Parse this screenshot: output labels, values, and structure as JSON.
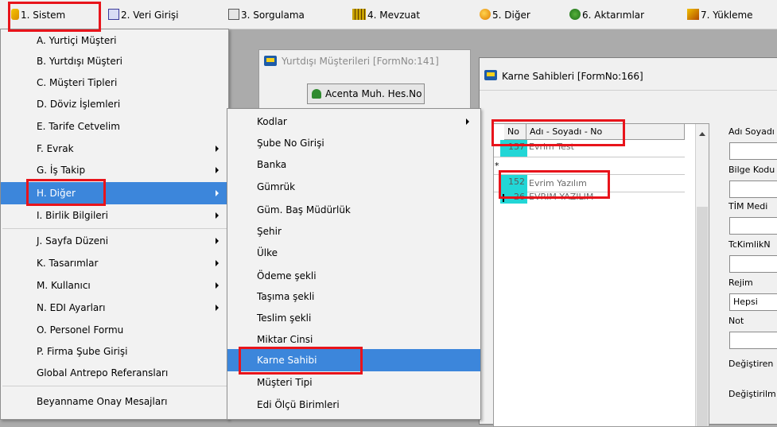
{
  "menubar": {
    "items": [
      {
        "label": "1.  Sistem",
        "icon": "system-icon"
      },
      {
        "label": "2.  Veri Girişi",
        "icon": "data-entry-icon"
      },
      {
        "label": "3.  Sorgulama",
        "icon": "query-icon"
      },
      {
        "label": "4.  Mevzuat",
        "icon": "books-icon"
      },
      {
        "label": "5.  Diğer",
        "icon": "other-icon"
      },
      {
        "label": "6.  Aktarımlar",
        "icon": "transfer-icon"
      },
      {
        "label": "7.  Yükleme",
        "icon": "upload-icon"
      }
    ]
  },
  "sistem_menu": {
    "items": [
      {
        "label": "A.  Yurtiçi Müşteri",
        "submenu": false
      },
      {
        "label": "B.  Yurtdışı Müşteri",
        "submenu": false
      },
      {
        "label": "C.  Müşteri Tipleri",
        "submenu": false
      },
      {
        "label": "D.  Döviz İşlemleri",
        "submenu": false
      },
      {
        "label": "E.  Tarife Cetvelim",
        "submenu": false
      },
      {
        "label": "F.  Evrak",
        "submenu": true
      },
      {
        "label": "G.  İş Takip",
        "submenu": true
      },
      {
        "label": "H.  Diğer",
        "submenu": true
      },
      {
        "label": "I.  Birlik Bilgileri",
        "submenu": true
      },
      {
        "label": "J.  Sayfa Düzeni",
        "submenu": true
      },
      {
        "label": "K.  Tasarımlar",
        "submenu": true
      },
      {
        "label": "M.  Kullanıcı",
        "submenu": true
      },
      {
        "label": "N.  EDI Ayarları",
        "submenu": true
      },
      {
        "label": "O.  Personel Formu",
        "submenu": false
      },
      {
        "label": "P.   Firma Şube Girişi",
        "submenu": false
      },
      {
        "label": "Global Antrepo Referansları",
        "submenu": false
      },
      {
        "label": "Beyanname Onay Mesajları",
        "submenu": false
      }
    ]
  },
  "diger_menu": {
    "items": [
      {
        "label": "Kodlar",
        "submenu": true
      },
      {
        "label": "Şube No Girişi",
        "submenu": false
      },
      {
        "label": "Banka",
        "submenu": false
      },
      {
        "label": "Gümrük",
        "submenu": false
      },
      {
        "label": "Güm. Baş Müdürlük",
        "submenu": false
      },
      {
        "label": "Şehir",
        "submenu": false
      },
      {
        "label": "Ülke",
        "submenu": false
      },
      {
        "label": "Ödeme şekli",
        "submenu": false
      },
      {
        "label": "Taşıma şekli",
        "submenu": false
      },
      {
        "label": "Teslim şekli",
        "submenu": false
      },
      {
        "label": "Miktar Cinsi",
        "submenu": false
      },
      {
        "label": "Karne Sahibi",
        "submenu": false
      },
      {
        "label": "Müşteri  Tipi",
        "submenu": false
      },
      {
        "label": "Edi Ölçü Birimleri",
        "submenu": false
      }
    ]
  },
  "yurtdisi_window": {
    "title": "Yurtdışı Müşterileri [FormNo:141]",
    "acenta_button": "Acenta Muh. Hes.No"
  },
  "karne_window": {
    "title": "Karne Sahibleri [FormNo:166]",
    "grid": {
      "columns": [
        "No",
        "Adı - Soyadı - No"
      ],
      "rows": [
        {
          "no": "157",
          "name": "Evrim Test"
        },
        {
          "no": "",
          "name": "",
          "marker": "*"
        },
        {
          "no": "152",
          "name": "Evrim Yazılım"
        },
        {
          "no": "26",
          "name": "EVRIM YAZILIM"
        }
      ]
    },
    "side_labels": {
      "adi_soyadi": "Adı Soyadı",
      "bilge_kodu": "Bilge Kodu",
      "tim_medi": "TİM Medi",
      "tckimlik": "TcKimlikN",
      "rejim": "Rejim",
      "rejim_value": "Hepsi",
      "not": "Not",
      "degistiren": "Değiştiren",
      "degistirilme": "Değiştirilm"
    }
  },
  "colors": {
    "highlight": "#3c86db",
    "annotation": "#e8141b",
    "row_no_bg": "#22d6d6"
  }
}
